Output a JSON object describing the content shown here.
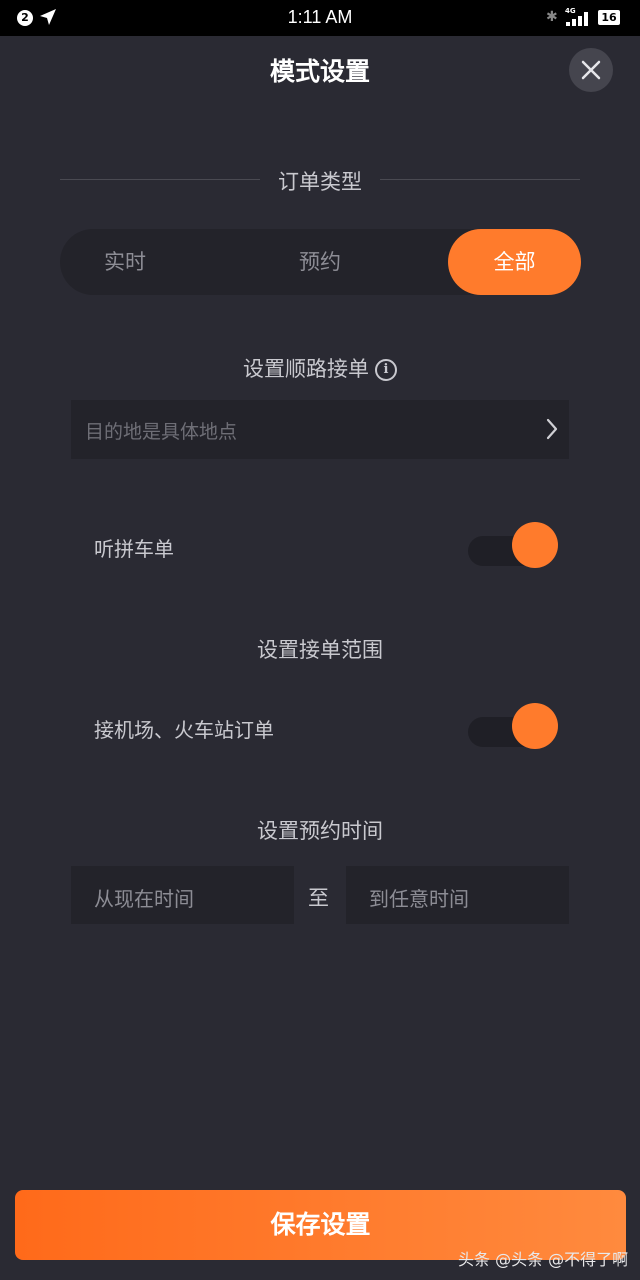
{
  "status_bar": {
    "notification_count": "2",
    "time": "1:11 AM",
    "network": "4G",
    "battery": "16"
  },
  "header": {
    "title": "模式设置"
  },
  "order_type": {
    "title": "订单类型",
    "options": [
      "实时",
      "预约",
      "全部"
    ],
    "selected": "全部"
  },
  "route": {
    "title": "设置顺路接单",
    "destination_placeholder": "目的地是具体地点"
  },
  "carpool": {
    "label": "听拼车单",
    "enabled": true
  },
  "range": {
    "title": "设置接单范围",
    "airport_label": "接机场、火车站订单",
    "airport_enabled": true
  },
  "schedule": {
    "title": "设置预约时间",
    "from_placeholder": "从现在时间",
    "to_label": "至",
    "to_placeholder": "到任意时间"
  },
  "footer": {
    "save_label": "保存设置",
    "watermark": "头条 @头条 @不得了啊"
  },
  "colors": {
    "accent": "#ff7b2c",
    "background": "#2a2a33",
    "field": "#23232a"
  }
}
